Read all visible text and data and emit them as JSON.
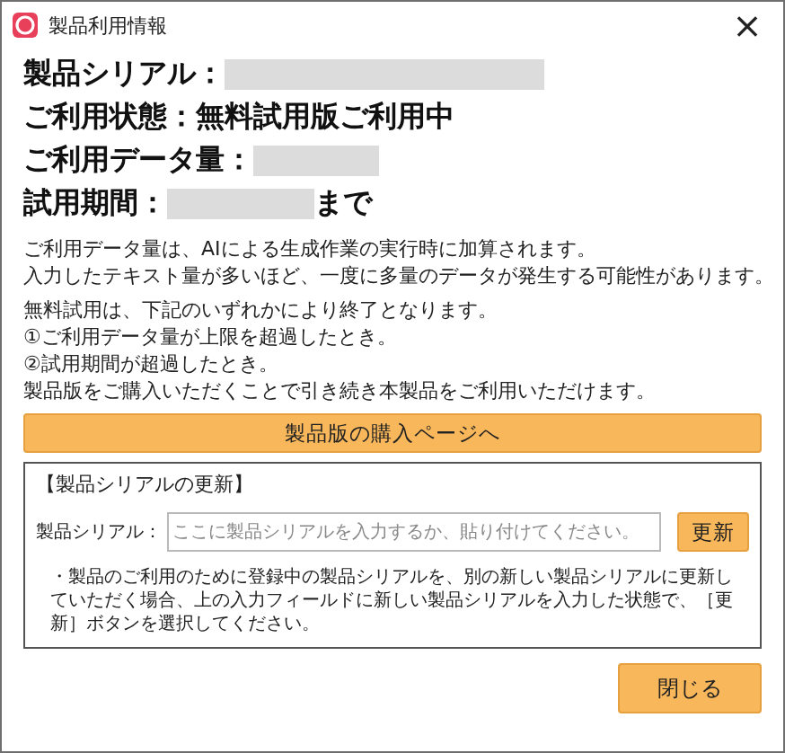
{
  "window": {
    "title": "製品利用情報",
    "close": "×"
  },
  "info_rows": [
    {
      "parts": [
        {
          "kind": "text",
          "text": "製品シリアル："
        },
        {
          "kind": "redacted"
        }
      ]
    },
    {
      "parts": [
        {
          "kind": "text",
          "text": "ご利用状態：無料試用版ご利用中"
        }
      ]
    },
    {
      "parts": [
        {
          "kind": "text",
          "text": "ご利用データ量："
        },
        {
          "kind": "redacted"
        }
      ]
    },
    {
      "parts": [
        {
          "kind": "text",
          "text": "試用期間："
        },
        {
          "kind": "redacted"
        },
        {
          "kind": "text",
          "text": "まで"
        }
      ]
    }
  ],
  "notes": [
    [
      "ご利用データ量は、AIによる生成作業の実行時に加算されます。",
      "入力したテキスト量が多いほど、一度に多量のデータが発生する可能性があります。"
    ],
    [
      "無料試用は、下記のいずれかにより終了となります。",
      "①ご利用データ量が上限を超過したとき。",
      "②試用期間が超過したとき。",
      "製品版をご購入いただくことで引き続き本製品をご利用いただけます。"
    ]
  ],
  "purchase_button": "製品版の購入ページへ",
  "serial_update": {
    "heading": "【製品シリアルの更新】",
    "field_label": "製品シリアル：",
    "placeholder": "ここに製品シリアルを入力するか、貼り付けてください。",
    "button": "更新",
    "note": "・製品のご利用のために登録中の製品シリアルを、別の新しい製品シリアルに更新していただく場合、上の入力フィールドに新しい製品シリアルを入力した状態で、［更新］ボタンを選択してください。"
  },
  "close_button": "閉じる"
}
